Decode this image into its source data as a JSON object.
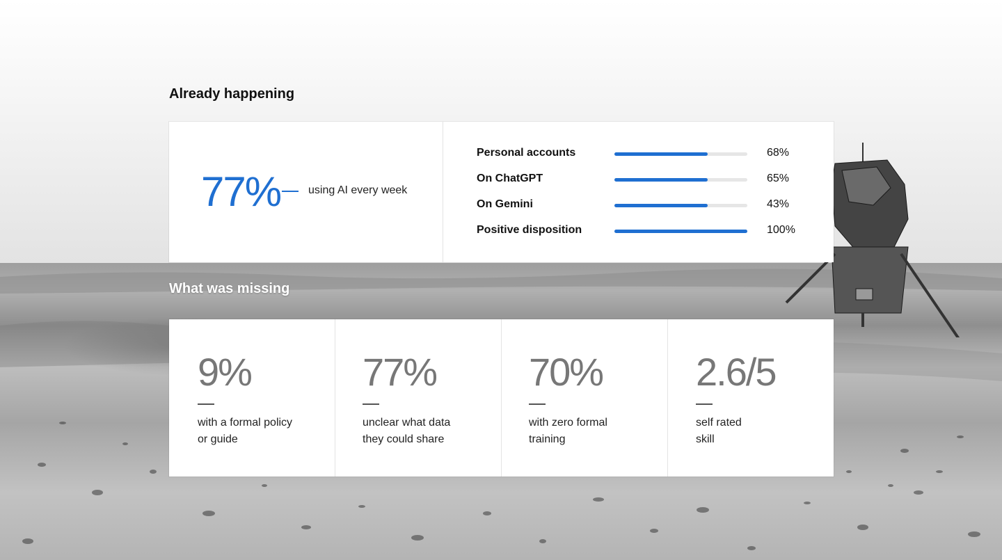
{
  "sections": {
    "happening_title": "Already happening",
    "missing_title": "What was missing"
  },
  "headline": {
    "value": "77%",
    "caption": "using AI every week"
  },
  "bars": [
    {
      "label": "Personal accounts",
      "value_text": "68%",
      "fill": 0.7
    },
    {
      "label": "On ChatGPT",
      "value_text": "65%",
      "fill": 0.7
    },
    {
      "label": "On Gemini",
      "value_text": "43%",
      "fill": 0.7
    },
    {
      "label": "Positive disposition",
      "value_text": "100%",
      "fill": 1.0
    }
  ],
  "missing": [
    {
      "value": "9%",
      "line1": "with a formal policy",
      "line2": "or guide"
    },
    {
      "value": "77%",
      "line1": "unclear what data",
      "line2": "they could share"
    },
    {
      "value": "70%",
      "line1": "with zero formal",
      "line2": "training"
    },
    {
      "value": "2.6/5",
      "line1": "self rated",
      "line2": "skill"
    }
  ],
  "colors": {
    "accent": "#1f6fd1",
    "stat_gray": "#777777"
  }
}
